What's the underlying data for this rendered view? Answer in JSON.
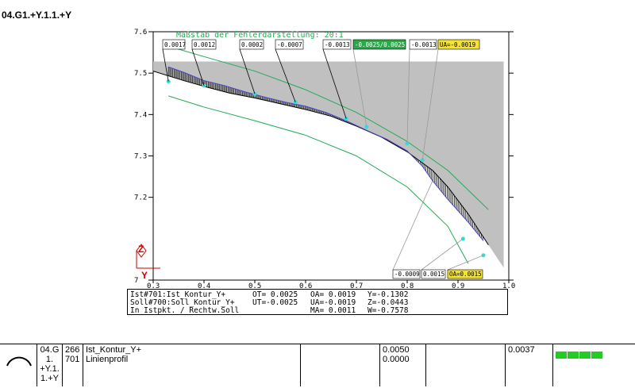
{
  "page_title": "04.G1.+Y.1.1.+Y",
  "colors": {
    "band": "#22aa55",
    "tolerance_box": "#2aa84a",
    "oa_ua_box": "#f2e23a",
    "measured_point": "#33dddd",
    "hatch": "#000000",
    "fill": "#c0c0c0",
    "deviation_curve": "#4444cc",
    "axis_z": "#cc0000",
    "axis_y": "#cc0000"
  },
  "chart_data": {
    "type": "line",
    "title": "Maßstab der Fehlerdarstellung: 20:1",
    "xlim": [
      0.3,
      1.0
    ],
    "ylim": [
      7.0,
      7.6
    ],
    "x_ticks": [
      "0.3",
      "0.4",
      "0.5",
      "0.6",
      "0.7",
      "0.8",
      "0.9",
      "1.0"
    ],
    "y_ticks": [
      "7.6",
      "7.5",
      "7.4",
      "7.3",
      "7.2",
      "7"
    ],
    "axis_z_label": "Z",
    "axis_y_label": "Y",
    "nominal_profile": {
      "x": [
        0.3,
        0.36,
        0.4,
        0.45,
        0.5,
        0.55,
        0.6,
        0.65,
        0.7,
        0.75,
        0.8,
        0.85,
        0.88,
        0.92,
        0.96
      ],
      "y": [
        7.505,
        7.482,
        7.468,
        7.452,
        7.44,
        7.426,
        7.412,
        7.396,
        7.372,
        7.345,
        7.31,
        7.265,
        7.225,
        7.16,
        7.085
      ]
    },
    "deviation_profile": {
      "x": [
        0.33,
        0.36,
        0.4,
        0.44,
        0.48,
        0.52,
        0.56,
        0.6,
        0.64,
        0.68,
        0.72,
        0.76,
        0.8,
        0.83,
        0.85,
        0.88,
        0.92,
        0.95
      ],
      "y": [
        7.515,
        7.502,
        7.482,
        7.47,
        7.455,
        7.442,
        7.43,
        7.42,
        7.405,
        7.385,
        7.362,
        7.34,
        7.312,
        7.275,
        7.24,
        7.195,
        7.14,
        7.095
      ]
    },
    "measured_points": {
      "x": [
        0.33,
        0.4,
        0.5,
        0.58,
        0.68,
        0.72,
        0.8,
        0.83,
        0.91,
        0.95
      ],
      "y": [
        7.48,
        7.47,
        7.45,
        7.43,
        7.39,
        7.37,
        7.33,
        7.29,
        7.1,
        7.06
      ]
    },
    "upper_tolerance_band": {
      "x": [
        0.33,
        0.4,
        0.5,
        0.6,
        0.7,
        0.8,
        0.88,
        0.96
      ],
      "y": [
        7.565,
        7.54,
        7.505,
        7.46,
        7.405,
        7.335,
        7.265,
        7.17
      ]
    },
    "lower_tolerance_band": {
      "x": [
        0.33,
        0.4,
        0.5,
        0.6,
        0.7,
        0.8,
        0.88,
        0.92
      ],
      "y": [
        7.445,
        7.418,
        7.385,
        7.35,
        7.3,
        7.225,
        7.13,
        7.04
      ]
    },
    "top_labels": [
      "0.0017",
      "0.0012",
      "0.0002",
      "-0.0007",
      "-0.0013",
      "-0.0025/0.0025",
      "-0.0013",
      "UA=-0.0019"
    ],
    "bottom_labels": [
      "-0.0009",
      "0.0015",
      "OA=0.0015"
    ]
  },
  "info": {
    "row1": "Ist#701:Ist_Kontur_Y+",
    "row2": "Soll#700:Soll_Kontur_Y+",
    "row3": "In Istpkt. / Rechtw.Soll",
    "ot": "OT= 0.0025",
    "ut": "UT=-0.0025",
    "oa": "OA= 0.0019",
    "ua": "UA=-0.0019",
    "ma": "MA= 0.0011",
    "yv": "Y=-0.1302",
    "zv": "Z=-0.0443",
    "wv": "W=-0.7578"
  },
  "feature_row": {
    "name_lines": [
      "04.G",
      "1.",
      "+Y.1.",
      "1.+Y"
    ],
    "ids": [
      "266",
      "701"
    ],
    "labels": [
      "Ist_Kontur_Y+",
      "Linienprofil"
    ],
    "values": [
      "0.0050",
      "0.0000"
    ],
    "measured": "0.0037",
    "profile_icon": "arc-profile-icon",
    "deviation_bar": 0.74
  }
}
